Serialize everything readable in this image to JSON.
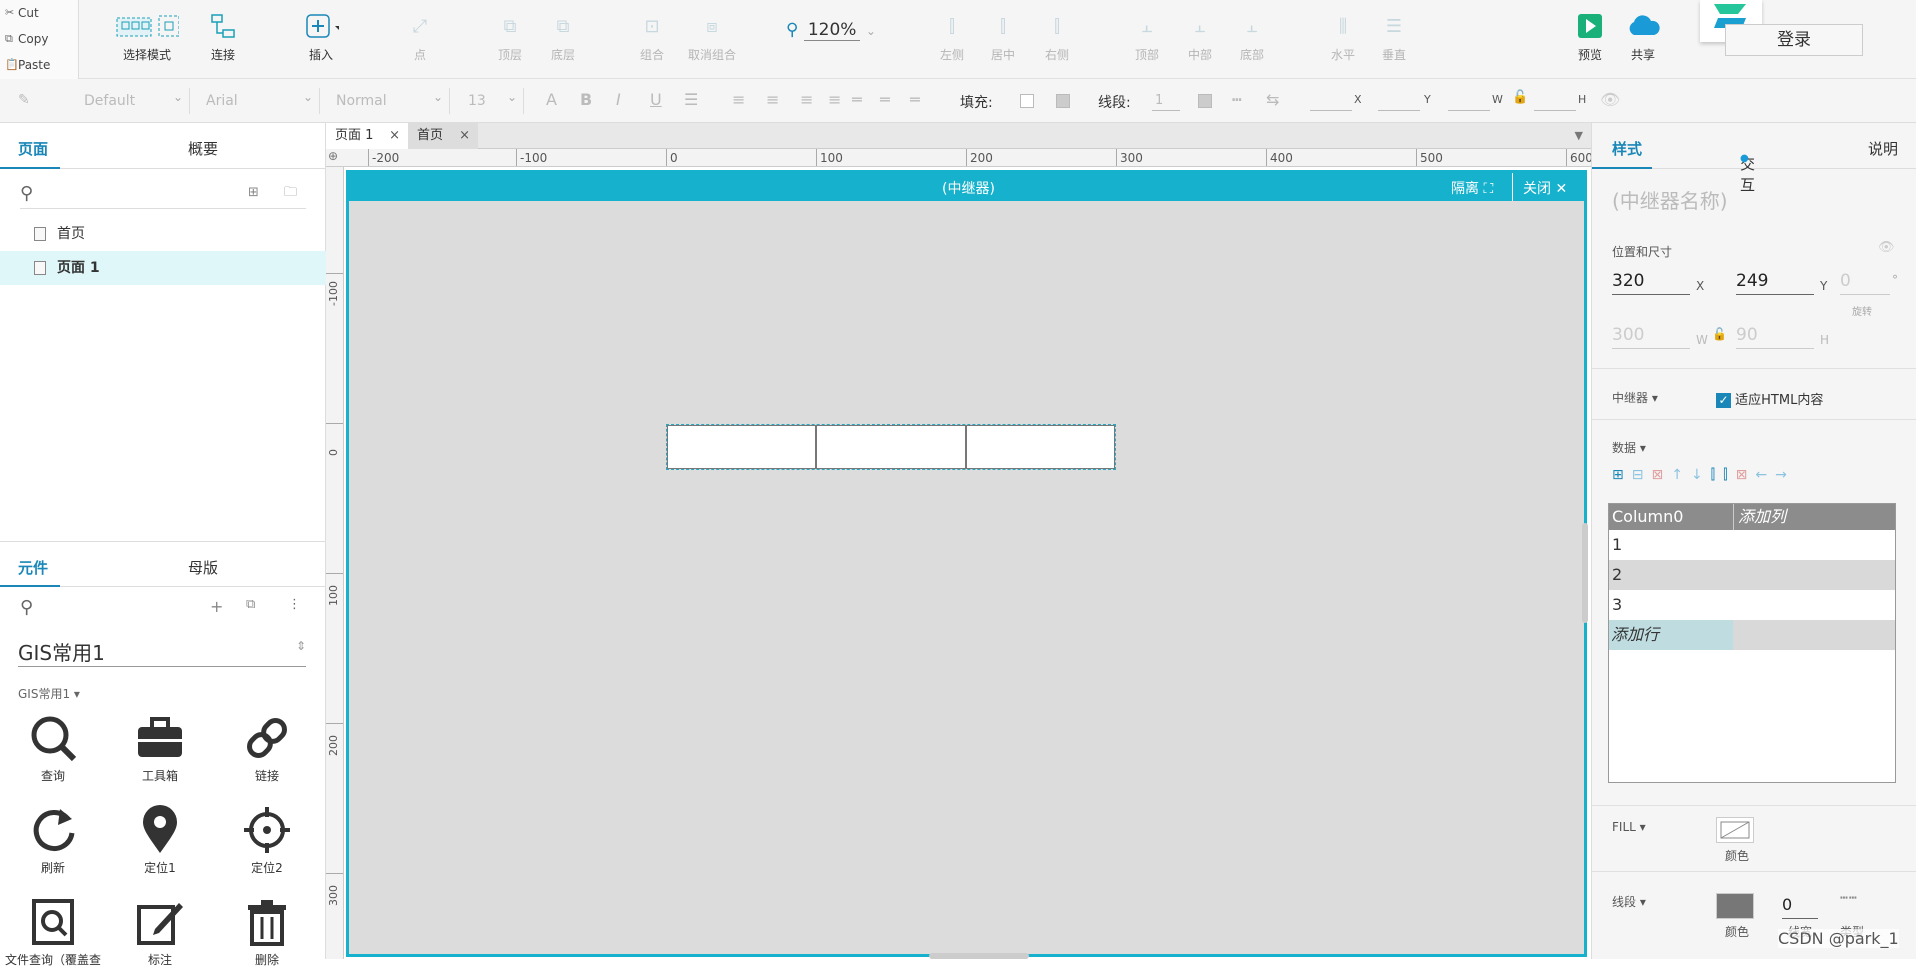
{
  "clipboard": {
    "cut": "Cut",
    "copy": "Copy",
    "paste": "Paste"
  },
  "toolbar": {
    "select_mode": "选择模式",
    "connect": "连接",
    "insert": "插入",
    "point": "点",
    "top_layer": "顶层",
    "bottom_layer": "底层",
    "group": "组合",
    "ungroup": "取消组合",
    "zoom": "120%",
    "align_left": "左侧",
    "align_center": "居中",
    "align_right": "右侧",
    "align_top": "顶部",
    "align_middle": "中部",
    "align_bottom": "底部",
    "horizontal": "水平",
    "vertical": "垂直",
    "preview": "预览",
    "share": "共享",
    "login": "登录"
  },
  "format": {
    "style": "Default",
    "font": "Arial",
    "weight": "Normal",
    "size": "13",
    "fill_label": "填充:",
    "line_label": "线段:",
    "line_value": "1",
    "x": "X",
    "y": "Y",
    "w": "W",
    "h": "H"
  },
  "left_panel": {
    "tab_pages": "页面",
    "tab_outline": "概要",
    "pages": [
      "首页",
      "页面 1"
    ],
    "tab_widgets": "元件",
    "tab_masters": "母版",
    "library_name": "GIS常用1",
    "library_group": "GIS常用1",
    "widgets": [
      "查询",
      "工具箱",
      "链接",
      "刷新",
      "定位1",
      "定位2",
      "文件查询（覆盖查",
      "标注",
      "删除"
    ]
  },
  "doc_tabs": [
    "页面 1",
    "首页"
  ],
  "ruler": {
    "h": [
      "-200",
      "-100",
      "0",
      "100",
      "200",
      "300",
      "400",
      "500",
      "600"
    ],
    "v": [
      "-100",
      "0",
      "100",
      "200",
      "300"
    ]
  },
  "repeater": {
    "title": "(中继器)",
    "isolate": "隔离",
    "close": "关闭"
  },
  "right_panel": {
    "tab_style": "样式",
    "tab_interact": "交互",
    "tab_notes": "说明",
    "name_placeholder": "(中继器名称)",
    "pos_size": "位置和尺寸",
    "x": "320",
    "y": "249",
    "rot": "0",
    "rot_label": "旋转",
    "deg": "°",
    "w": "300",
    "h": "90",
    "lbl_x": "X",
    "lbl_y": "Y",
    "lbl_w": "W",
    "lbl_h": "H",
    "repeater_label": "中继器",
    "fit_html": "适应HTML内容",
    "data_label": "数据",
    "grid_header": [
      "Column0",
      "添加列"
    ],
    "grid_rows": [
      "1",
      "2",
      "3"
    ],
    "add_row": "添加行",
    "fill_label": "FILL",
    "fill_color": "颜色",
    "line_label": "线段",
    "line_color": "颜色",
    "line_width": "0",
    "line_width_label": "线宽",
    "line_type": "类型"
  },
  "watermark": "CSDN @park_1",
  "colors": {
    "accent": "#16b1cc",
    "blue": "#1a87b8"
  }
}
